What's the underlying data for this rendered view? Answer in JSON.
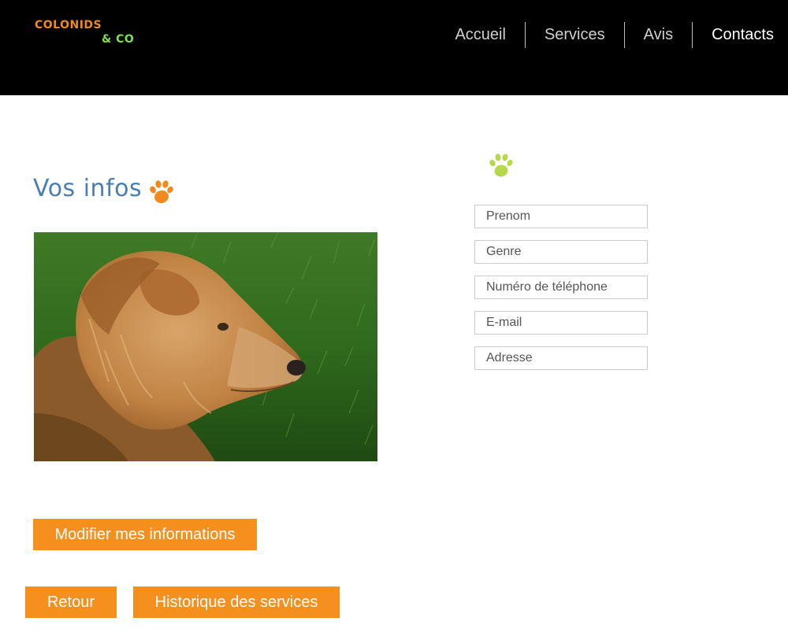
{
  "brand": {
    "line1": "COLONIDS",
    "line2": "& CO",
    "color1": "#f18a1e",
    "color2": "#7ee04c"
  },
  "nav": {
    "items": [
      {
        "label": "Accueil"
      },
      {
        "label": "Services"
      },
      {
        "label": "Avis"
      },
      {
        "label": "Contacts"
      }
    ],
    "active": "Contacts"
  },
  "main": {
    "title": "Vos infos",
    "title_icon": "paw-icon",
    "photo_icon": "dog-photo",
    "form_icon": "paw-icon"
  },
  "form": {
    "fields": [
      {
        "placeholder": "Prenom",
        "value": ""
      },
      {
        "placeholder": "Genre",
        "value": ""
      },
      {
        "placeholder": "Numéro de téléphone",
        "value": ""
      },
      {
        "placeholder": "E-mail",
        "value": ""
      },
      {
        "placeholder": "Adresse",
        "value": ""
      }
    ]
  },
  "buttons": {
    "modify": "Modifier mes informations",
    "back": "Retour",
    "history": "Historique des services"
  },
  "colors": {
    "accent": "#f5901e",
    "title": "#4a7fb3",
    "paw_orange": "#f18a1e",
    "paw_green": "#b6d94a",
    "header_bg": "#000000"
  }
}
